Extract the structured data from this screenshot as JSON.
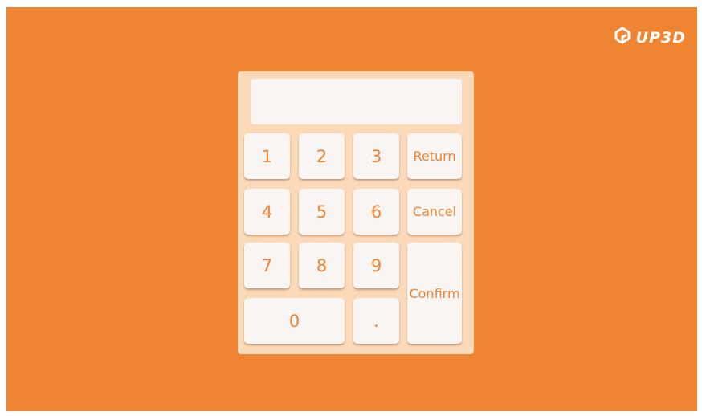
{
  "brand": {
    "name": "UP3D",
    "icon": "up3d-logo-icon"
  },
  "display": {
    "value": ""
  },
  "keys": {
    "k1": "1",
    "k2": "2",
    "k3": "3",
    "k4": "4",
    "k5": "5",
    "k6": "6",
    "k7": "7",
    "k8": "8",
    "k9": "9",
    "k0": "0",
    "dot": ".",
    "return": "Return",
    "cancel": "Cancel",
    "confirm": "Confirm"
  },
  "colors": {
    "background": "#ef8433",
    "keypad": "#fcd9b9",
    "key": "#f9f5f2",
    "key_text": "#ef8433"
  }
}
